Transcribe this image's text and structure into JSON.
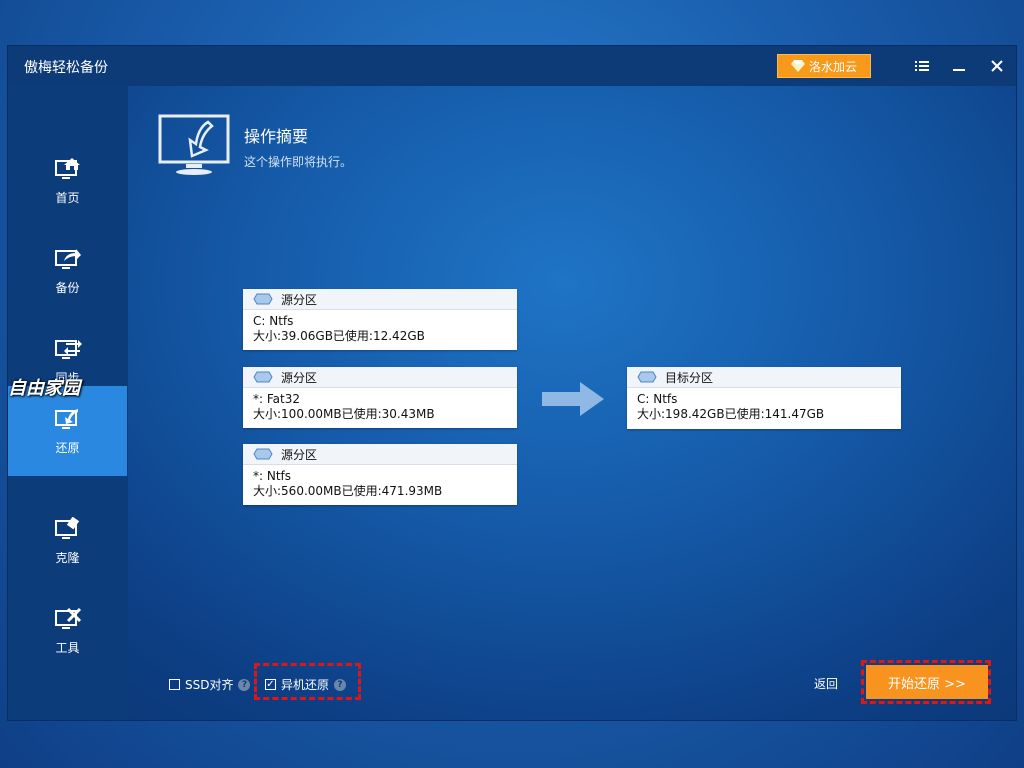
{
  "window": {
    "title": "傲梅轻松备份",
    "cloud_button": "洛水加云"
  },
  "sidebar": {
    "items": [
      {
        "label": "首页",
        "icon": "home-icon"
      },
      {
        "label": "备份",
        "icon": "backup-icon"
      },
      {
        "label": "同步",
        "icon": "sync-icon"
      },
      {
        "label": "还原",
        "icon": "restore-icon",
        "active": true
      },
      {
        "label": "克隆",
        "icon": "clone-icon"
      },
      {
        "label": "工具",
        "icon": "tools-icon"
      }
    ],
    "watermark": "自由家园"
  },
  "summary": {
    "title": "操作摘要",
    "subtitle": "这个操作即将执行。"
  },
  "sources": [
    {
      "header": "源分区",
      "line1": "C: Ntfs",
      "line2": "大小:39.06GB已使用:12.42GB"
    },
    {
      "header": "源分区",
      "line1": "*: Fat32",
      "line2": "大小:100.00MB已使用:30.43MB"
    },
    {
      "header": "源分区",
      "line1": "*: Ntfs",
      "line2": "大小:560.00MB已使用:471.93MB"
    }
  ],
  "target": {
    "header": "目标分区",
    "line1": "C: Ntfs",
    "line2": "大小:198.42GB已使用:141.47GB"
  },
  "options": {
    "ssd_align": {
      "label": "SSD对齐",
      "checked": false
    },
    "universal_restore": {
      "label": "异机还原",
      "checked": true
    }
  },
  "footer": {
    "back": "返回",
    "start": "开始还原 >>"
  },
  "colors": {
    "accent": "#f7931e",
    "sidebar": "#0d3c7a",
    "active": "#2a88e0",
    "highlight": "#e01515"
  }
}
